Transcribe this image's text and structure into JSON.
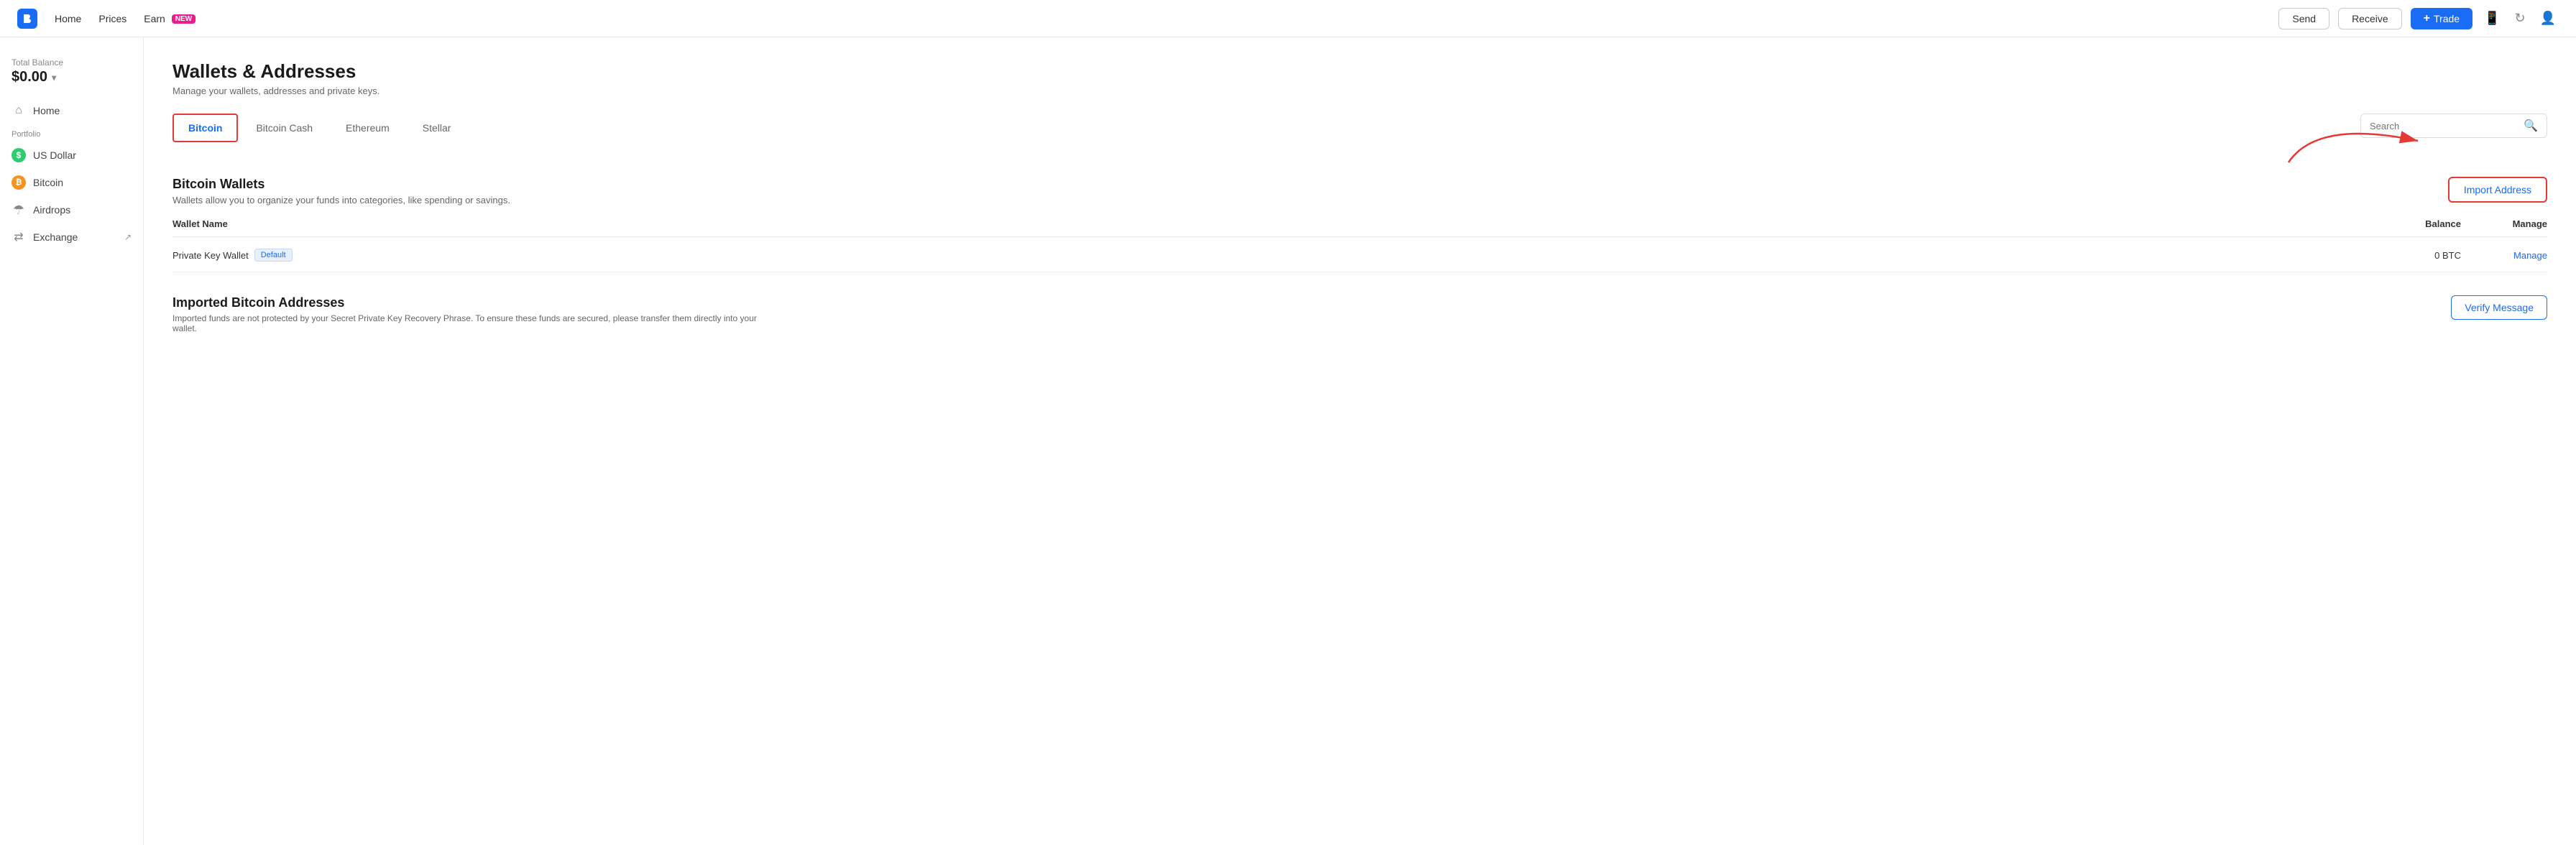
{
  "topnav": {
    "logo_alt": "Blockchain Logo",
    "links": [
      {
        "label": "Home",
        "id": "home"
      },
      {
        "label": "Prices",
        "id": "prices"
      },
      {
        "label": "Earn",
        "id": "earn",
        "badge": "NEW"
      }
    ],
    "send_label": "Send",
    "receive_label": "Receive",
    "trade_label": "Trade",
    "trade_plus": "+"
  },
  "sidebar": {
    "balance_label": "Total Balance",
    "balance_value": "$0.00",
    "portfolio_label": "Portfolio",
    "items": [
      {
        "id": "home",
        "label": "Home",
        "icon": "home"
      },
      {
        "id": "usdollar",
        "label": "US Dollar",
        "icon": "usd"
      },
      {
        "id": "bitcoin",
        "label": "Bitcoin",
        "icon": "btc"
      },
      {
        "id": "airdrops",
        "label": "Airdrops",
        "icon": "airdrop"
      },
      {
        "id": "exchange",
        "label": "Exchange",
        "icon": "exchange",
        "ext": "↗"
      }
    ]
  },
  "page": {
    "title": "Wallets & Addresses",
    "subtitle": "Manage your wallets, addresses and private keys."
  },
  "tabs": [
    {
      "id": "bitcoin",
      "label": "Bitcoin",
      "active": true
    },
    {
      "id": "bitcoin-cash",
      "label": "Bitcoin Cash",
      "active": false
    },
    {
      "id": "ethereum",
      "label": "Ethereum",
      "active": false
    },
    {
      "id": "stellar",
      "label": "Stellar",
      "active": false
    }
  ],
  "search": {
    "placeholder": "Search"
  },
  "wallets_section": {
    "title": "Bitcoin Wallets",
    "desc": "Wallets allow you to organize your funds into categories, like spending or savings.",
    "import_button_label": "Import Address",
    "table_headers": {
      "name": "Wallet Name",
      "balance": "Balance",
      "manage": "Manage"
    },
    "rows": [
      {
        "name": "Private Key Wallet",
        "badge": "Default",
        "balance": "0 BTC",
        "manage_label": "Manage"
      }
    ]
  },
  "imported_section": {
    "title": "Imported Bitcoin Addresses",
    "desc": "Imported funds are not protected by your Secret Private Key Recovery Phrase. To ensure these funds are secured, please transfer them directly into your wallet.",
    "verify_button_label": "Verify Message"
  },
  "icons": {
    "search": "🔍",
    "mobile": "📱",
    "refresh": "↻",
    "user": "👤",
    "home_glyph": "⌂",
    "airdrop_glyph": "☂",
    "exchange_glyph": "⇄"
  }
}
